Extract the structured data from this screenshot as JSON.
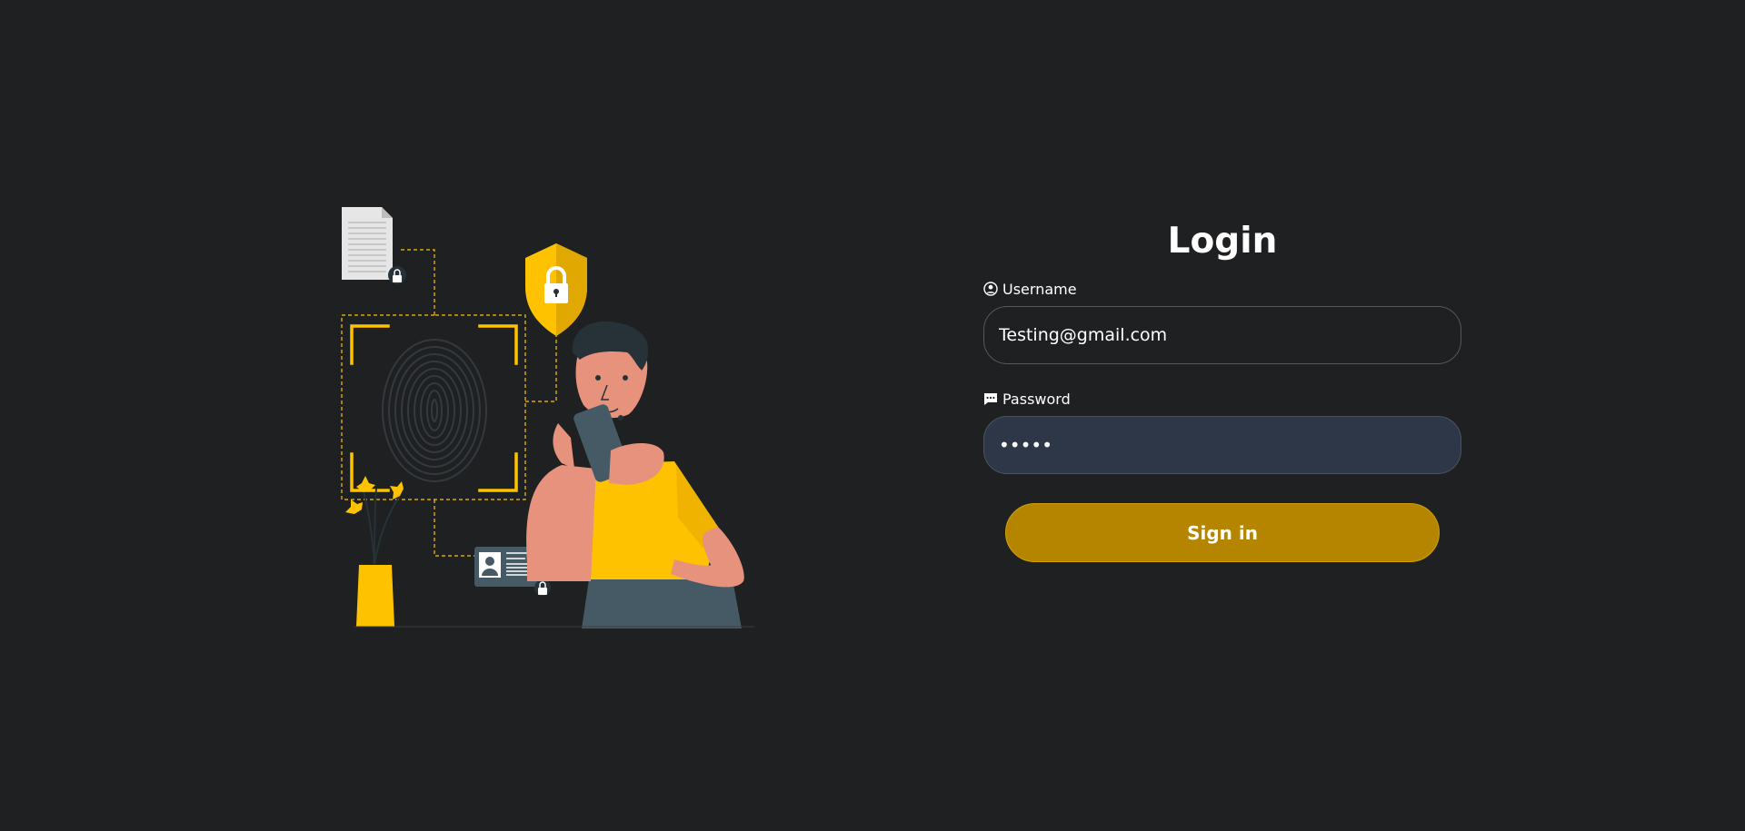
{
  "login": {
    "title": "Login",
    "username": {
      "label": "Username",
      "value": "Testing@gmail.com",
      "icon": "user-circle-icon"
    },
    "password": {
      "label": "Password",
      "value": "•••••",
      "icon": "message-dots-icon"
    },
    "submit_label": "Sign in"
  },
  "illustration": {
    "subject": "fingerprint-security-person-with-phone"
  },
  "colors": {
    "background": "#1f2022",
    "accent": "#b58500",
    "illustration_yellow": "#ffc200",
    "input_border": "#54575c",
    "password_bg": "#2e3747"
  }
}
